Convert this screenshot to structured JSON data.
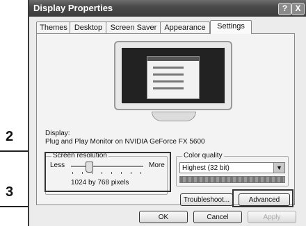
{
  "annotations": {
    "marker_2": "2",
    "marker_3": "3"
  },
  "window": {
    "title": "Display Properties",
    "help_label": "?",
    "close_label": "X"
  },
  "tabs": [
    {
      "label": "Themes"
    },
    {
      "label": "Desktop"
    },
    {
      "label": "Screen Saver"
    },
    {
      "label": "Appearance"
    },
    {
      "label": "Settings"
    }
  ],
  "display": {
    "label": "Display:",
    "value": "Plug and Play Monitor on NVIDIA GeForce FX 5600"
  },
  "resolution": {
    "legend": "Screen resolution",
    "less_label": "Less",
    "more_label": "More",
    "value_text": "1024 by 768 pixels",
    "slider_level": 0.25
  },
  "color_quality": {
    "legend": "Color quality",
    "selected": "Highest (32 bit)"
  },
  "buttons": {
    "troubleshoot": "Troubleshoot...",
    "advanced": "Advanced",
    "ok": "OK",
    "cancel": "Cancel",
    "apply": "Apply"
  }
}
